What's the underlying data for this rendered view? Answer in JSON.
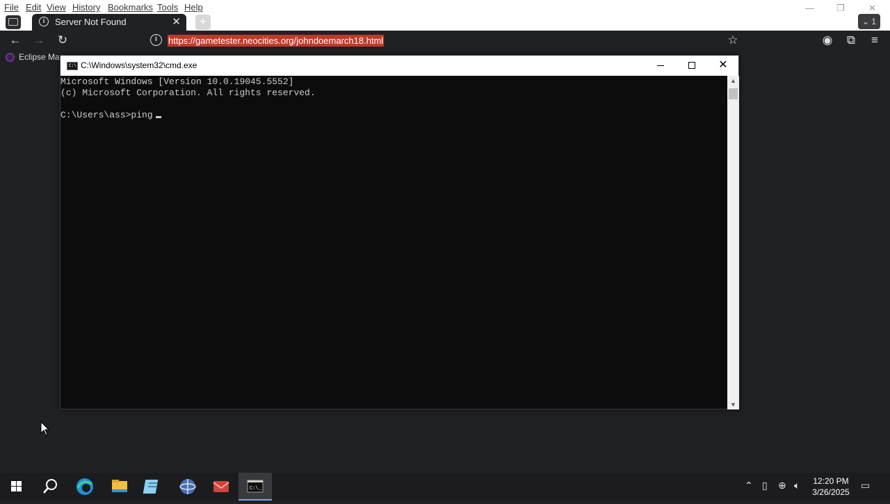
{
  "browser": {
    "menu": [
      "File",
      "Edit",
      "View",
      "History",
      "Bookmarks",
      "Tools",
      "Help"
    ],
    "tab": {
      "title": "Server Not Found"
    },
    "tabs_count": "1",
    "url": "https://gametester.neocities.org/johndoemarch18.html",
    "bookmarks": [
      "Eclipse Mar"
    ]
  },
  "cmd": {
    "title": "C:\\Windows\\system32\\cmd.exe",
    "lines": [
      "Microsoft Windows [Version 10.0.19045.5552]",
      "(c) Microsoft Corporation. All rights reserved.",
      "",
      "C:\\Users\\ass>ping"
    ]
  },
  "taskbar": {
    "time": "12:20 PM",
    "date": "3/26/2025",
    "apps": [
      "windows-start-icon",
      "search-icon",
      "edge-icon",
      "file-explorer-icon",
      "notepad-icon",
      "globe-app-icon",
      "app-icon",
      "cmd-icon"
    ]
  },
  "colors": {
    "url_highlight": "#c0392b",
    "console_bg": "#0c0c0c",
    "taskbar": "#1c1c1f"
  }
}
